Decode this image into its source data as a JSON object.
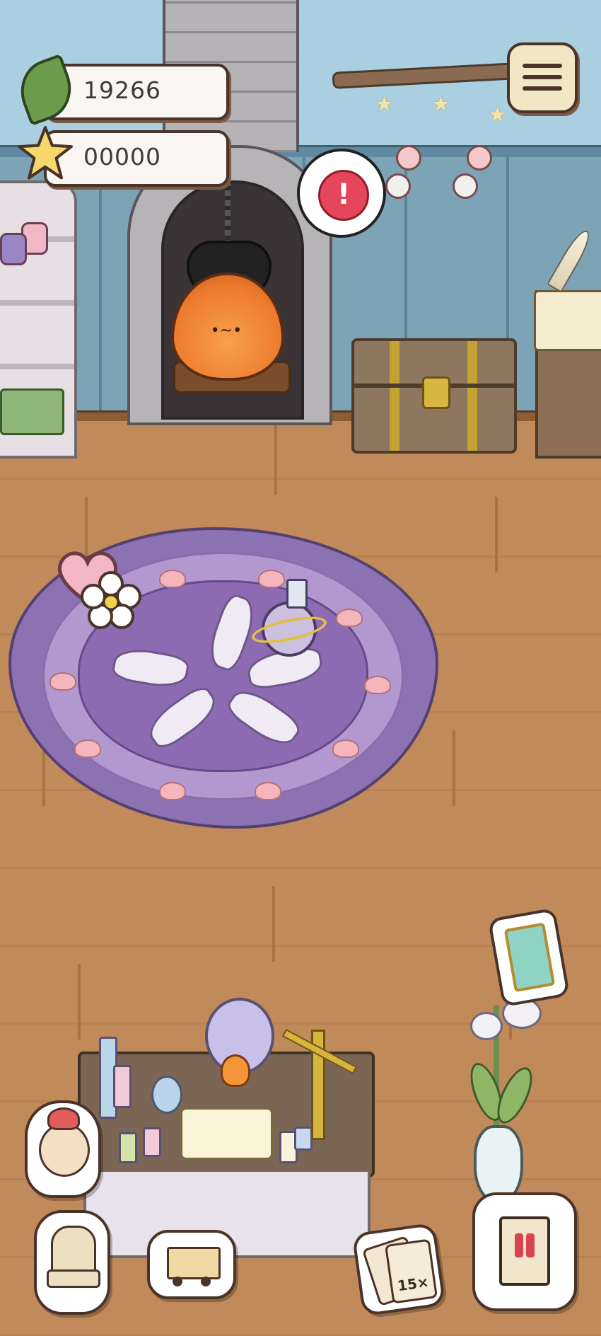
{
  "hud": {
    "leaves_value": "19266",
    "stars_value": "00000",
    "leaf_icon": "leaf-icon",
    "star_icon": "star-icon",
    "menu_icon": "menu-icon",
    "alert_icon": "exclamation-icon",
    "alert_symbol": "!"
  },
  "scene": {
    "flame_face": "•~•"
  },
  "bottom_bar": {
    "items": [
      {
        "icon": "character-icon"
      },
      {
        "icon": "chair-icon"
      },
      {
        "icon": "shopping-cart-icon"
      },
      {
        "icon": "cards-icon",
        "label": "15×"
      },
      {
        "icon": "signboard-icon"
      }
    ]
  },
  "side_items": {
    "phone_icon": "phone-icon",
    "heart_icon": "heart-flower-icon"
  },
  "colors": {
    "wall": "#7fa6b8",
    "floor": "#c08a5a",
    "rug": "#8d72b3",
    "alert": "#e6465c"
  }
}
